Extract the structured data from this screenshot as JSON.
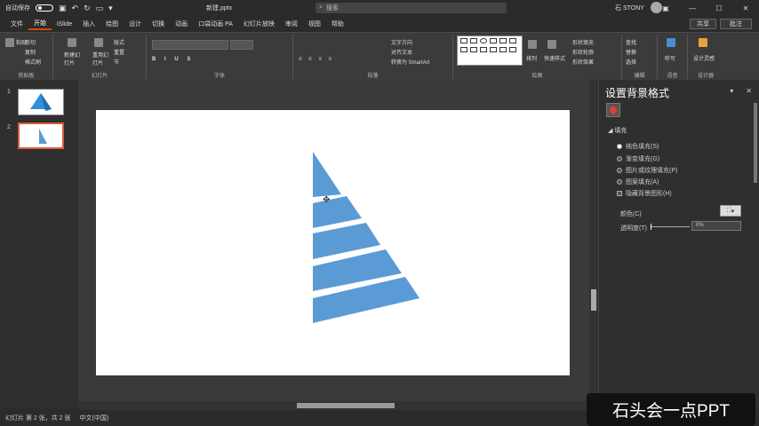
{
  "titlebar": {
    "autosave": "自动保存",
    "doc_title": "新建.pptx",
    "search": "搜索",
    "user": "石 STONY"
  },
  "tabs": [
    "文件",
    "开始",
    "iSlide",
    "插入",
    "绘图",
    "设计",
    "切换",
    "动画",
    "口袋动画 PA",
    "幻灯片放映",
    "审阅",
    "视图",
    "帮助"
  ],
  "active_tab": "开始",
  "actions": {
    "share": "共享",
    "comments": "批注"
  },
  "ribbon": {
    "groups": [
      "剪贴板",
      "幻灯片",
      "字体",
      "段落",
      "绘图",
      "编辑",
      "语音",
      "设计器"
    ],
    "clipboard": {
      "paste": "粘贴",
      "cut": "剪切",
      "copy": "复制",
      "format_painter": "格式刷"
    },
    "slides": {
      "new_slide": "新建幻灯片",
      "reuse": "重用幻灯片",
      "layout": "版式",
      "reset": "重置",
      "section": "节"
    },
    "paragraph": {
      "text_direction": "文字方向",
      "align_text": "对齐文本",
      "smartart": "转换为 SmartArt"
    },
    "drawing": {
      "arrange": "排列",
      "quick_styles": "快速样式",
      "shape_fill": "形状填充",
      "shape_outline": "形状轮廓",
      "shape_effects": "形状效果"
    },
    "editing": {
      "find": "查找",
      "replace": "替换",
      "select": "选择"
    },
    "voice": {
      "dictate": "听写"
    },
    "designer": {
      "design_ideas": "设计灵感"
    }
  },
  "slides_pane": {
    "items": [
      {
        "num": "1"
      },
      {
        "num": "2"
      }
    ],
    "selected": 2
  },
  "format_pane": {
    "title": "设置背景格式",
    "section": "填充",
    "options": [
      {
        "label": "纯色填充(S)",
        "type": "radio",
        "checked": true
      },
      {
        "label": "渐变填充(G)",
        "type": "radio",
        "checked": false
      },
      {
        "label": "图片或纹理填充(P)",
        "type": "radio",
        "checked": false
      },
      {
        "label": "图案填充(A)",
        "type": "radio",
        "checked": false
      },
      {
        "label": "隐藏背景图形(H)",
        "type": "checkbox",
        "checked": false
      }
    ],
    "color_label": "颜色(C)",
    "transparency_label": "透明度(T)",
    "transparency_value": "0%",
    "transparency_level": 0
  },
  "slide_content": {
    "fill_color": "#5b9bd5"
  },
  "statusbar": {
    "slide_info": "幻灯片 第 2 张，共 2 张",
    "language": "中文(中国)"
  },
  "watermark": "石头会一点PPT"
}
